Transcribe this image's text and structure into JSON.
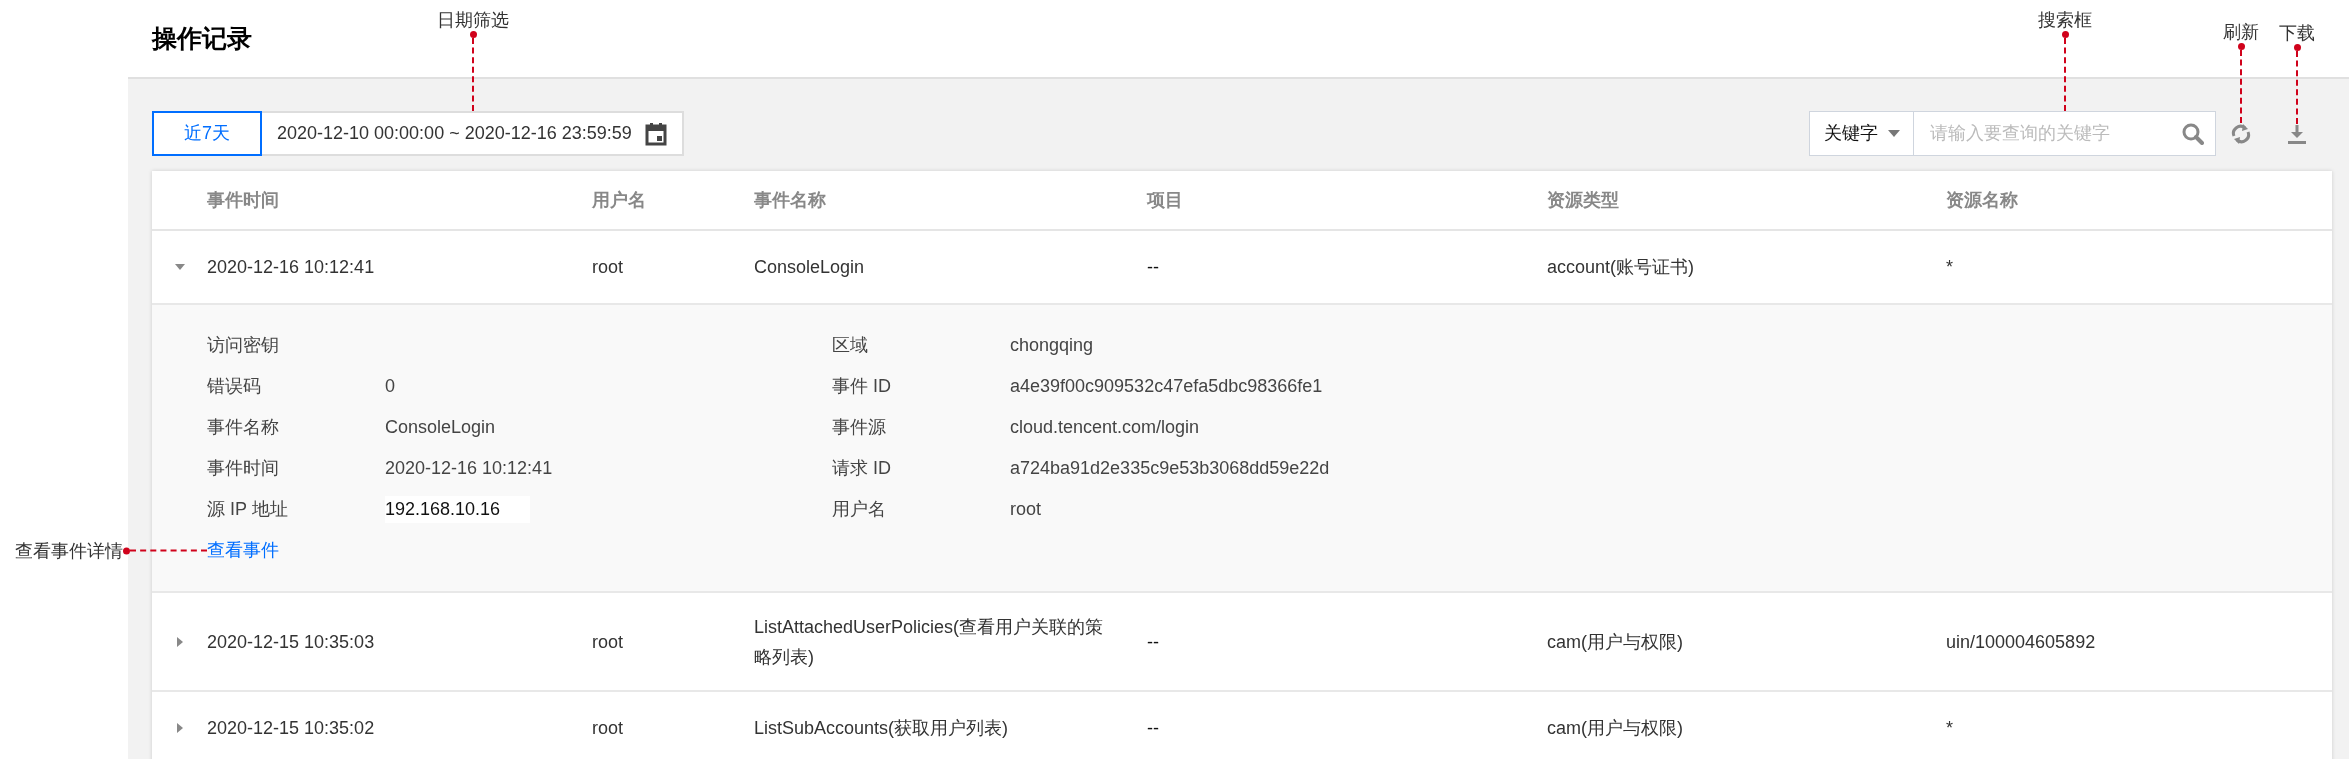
{
  "page_title": "操作记录",
  "toolbar": {
    "range_button": {
      "label": "近7天",
      "selected": true
    },
    "date_range": {
      "value": "2020-12-10 00:00:00 ~ 2020-12-16 23:59:59",
      "callout": "日期筛选"
    },
    "search": {
      "filter": "关键字",
      "placeholder": "请输入要查询的关键字",
      "callout": "搜索框"
    },
    "refresh": {
      "callout": "刷新"
    },
    "download": {
      "callout": "下载"
    }
  },
  "table": {
    "columns": [
      "事件时间",
      "用户名",
      "事件名称",
      "项目",
      "资源类型",
      "资源名称"
    ],
    "rows": [
      {
        "expanded": true,
        "cells": [
          "2020-12-16 10:12:41",
          "root",
          "ConsoleLogin",
          "--",
          "account(账号证书)",
          "*"
        ],
        "details": {
          "left": [
            {
              "label": "访问密钥"
            },
            {
              "label": "错误码",
              "value": "0"
            },
            {
              "label": "事件名称",
              "value": "ConsoleLogin"
            },
            {
              "label": "事件时间",
              "value": "2020-12-16 10:12:41"
            },
            {
              "label": "源 IP 地址",
              "value": "192.168.10.16"
            }
          ],
          "right": [
            {
              "label": "区域",
              "value": "chongqing"
            },
            {
              "label": "事件 ID",
              "value": "a4e39f00c909532c47efa5dbc98366fe1"
            },
            {
              "label": "事件源",
              "value": "cloud.tencent.com/login"
            },
            {
              "label": "请求 ID",
              "value": "a724ba91d2e335c9e53b3068dd59e22d"
            },
            {
              "label": "用户名",
              "value": "root"
            }
          ],
          "link": "查看事件",
          "callout": "查看事件详情"
        }
      },
      {
        "expanded": false,
        "cells": [
          "2020-12-15 10:35:03",
          "root",
          "ListAttachedUserPolicies(查看用户关联的策略列表)",
          "--",
          "cam(用户与权限)",
          "uin/100004605892"
        ]
      },
      {
        "expanded": false,
        "cells": [
          "2020-12-15 10:35:02",
          "root",
          "ListSubAccounts(获取用户列表)",
          "--",
          "cam(用户与权限)",
          "*"
        ]
      }
    ]
  }
}
